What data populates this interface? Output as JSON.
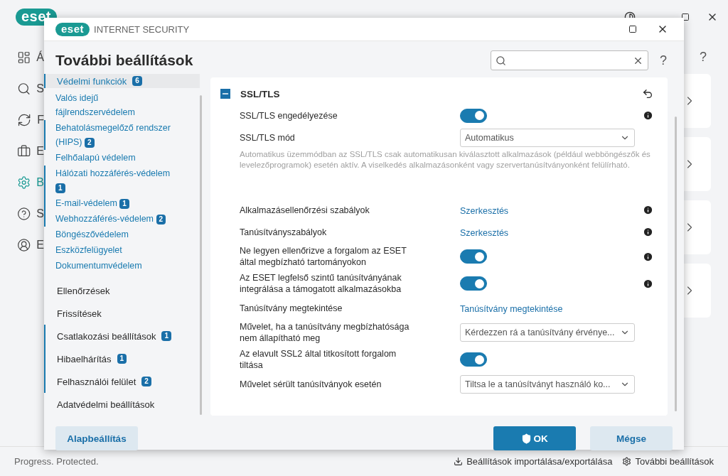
{
  "background_app": {
    "logo_text": "eset",
    "help": "?",
    "nav": [
      {
        "label": "Á",
        "selected": false
      },
      {
        "label": "S",
        "selected": false
      },
      {
        "label": "F",
        "selected": false
      },
      {
        "label": "E",
        "selected": false
      },
      {
        "label": "B",
        "selected": true
      },
      {
        "label": "S",
        "selected": false
      },
      {
        "label": "E",
        "selected": false
      }
    ],
    "status": "Progress. Protected.",
    "footer_links": [
      {
        "label": "Beállítások importálása/exportálása"
      },
      {
        "label": "További beállítások"
      }
    ]
  },
  "dialog": {
    "logo_text": "eset",
    "product": "INTERNET SECURITY",
    "title": "További beállítások",
    "help": "?",
    "sidebar": {
      "items": [
        {
          "label": "Védelmi funkciók",
          "badge": "6",
          "selected": true,
          "children": [
            {
              "label": "Valós idejű fájlrendszervédelem"
            },
            {
              "label": "Behatolásmegelőző rendszer (HIPS)",
              "badge": "2"
            },
            {
              "label": "Felhőalapú védelem"
            },
            {
              "label": "Hálózati hozzáférés-védelem",
              "badge": "1"
            },
            {
              "label": "E-mail-védelem",
              "badge": "1"
            },
            {
              "label": "Webhozzáférés-védelem",
              "badge": "2"
            },
            {
              "label": "Böngészővédelem"
            },
            {
              "label": "Eszközfelügyelet"
            },
            {
              "label": "Dokumentumvédelem"
            }
          ]
        },
        {
          "label": "Ellenőrzések",
          "selected": false
        },
        {
          "label": "Frissítések",
          "selected": false
        },
        {
          "label": "Csatlakozási beállítások",
          "badge": "1",
          "selected": false
        },
        {
          "label": "Hibaelhárítás",
          "badge": "1",
          "selected": false
        },
        {
          "label": "Felhasználói felület",
          "badge": "2",
          "selected": false
        },
        {
          "label": "Adatvédelmi beállítások",
          "selected": false
        }
      ]
    },
    "section": {
      "title": "SSL/TLS",
      "expanded": true,
      "rows": [
        {
          "kind": "toggle",
          "label": "SSL/TLS engedélyezése",
          "on": true,
          "info": true
        },
        {
          "kind": "select",
          "label": "SSL/TLS mód",
          "value": "Automatikus",
          "info": false,
          "note": "Automatikus üzemmódban az SSL/TLS csak automatikusan kiválasztott alkalmazások (például webböngészők és levelezőprogramok) esetén aktív. A viselkedés alkalmazásonként vagy szervertanúsítványonként felülírható."
        },
        {
          "kind": "link",
          "label": "Alkalmazásellenőrzési szabályok",
          "value": "Szerkesztés",
          "info": true
        },
        {
          "kind": "link",
          "label": "Tanúsítványszabályok",
          "value": "Szerkesztés",
          "info": true
        },
        {
          "kind": "toggle",
          "label": "Ne legyen ellenőrizve a forgalom az ESET által megbízható tartományokon",
          "on": true,
          "info": true
        },
        {
          "kind": "toggle",
          "label": "Az ESET legfelső szintű tanúsítványának integrálása a támogatott alkalmazásokba",
          "on": true,
          "info": true
        },
        {
          "kind": "link",
          "label": "Tanúsítvány megtekintése",
          "value": "Tanúsítvány megtekintése",
          "info": false
        },
        {
          "kind": "select",
          "label": "Művelet, ha a tanúsítvány megbízhatósága nem állapítható meg",
          "value": "Kérdezzen rá a tanúsítvány érvénye...",
          "info": false
        },
        {
          "kind": "toggle",
          "label": "Az elavult SSL2 által titkosított forgalom tiltása",
          "on": true,
          "info": false
        },
        {
          "kind": "select",
          "label": "Művelet sérült tanúsítványok esetén",
          "value": "Tiltsa le a tanúsítványt használó ko...",
          "info": false
        }
      ]
    },
    "buttons": [
      {
        "label": "Alapbeállítás",
        "kind": "secondary"
      },
      {
        "label": "OK",
        "kind": "primary"
      },
      {
        "label": "Mégse",
        "kind": "secondary"
      }
    ]
  }
}
